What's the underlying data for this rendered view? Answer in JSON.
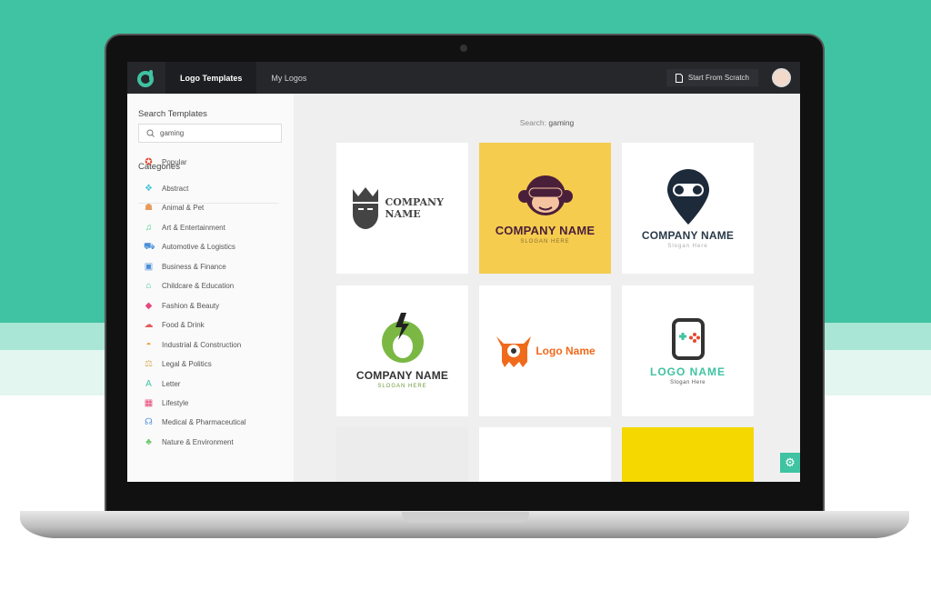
{
  "nav": {
    "tabs": [
      {
        "label": "Logo Templates",
        "active": true
      },
      {
        "label": "My Logos",
        "active": false
      }
    ],
    "start_from_scratch": "Start From Scratch"
  },
  "sidebar": {
    "search_heading": "Search Templates",
    "search_value": "gaming",
    "categories_heading": "Categories",
    "categories": [
      {
        "label": "Popular",
        "icon": "star-icon",
        "color": "#e8472e"
      },
      {
        "label": "Abstract",
        "icon": "abstract-icon",
        "color": "#49c6d8"
      },
      {
        "label": "Animal & Pet",
        "icon": "paw-icon",
        "color": "#e89a5a"
      },
      {
        "label": "Art & Entertainment",
        "icon": "music-note-icon",
        "color": "#4ccf8c"
      },
      {
        "label": "Automotive & Logistics",
        "icon": "car-icon",
        "color": "#4a8fd8"
      },
      {
        "label": "Business & Finance",
        "icon": "briefcase-icon",
        "color": "#4a8fd8"
      },
      {
        "label": "Childcare & Education",
        "icon": "graduation-cap-icon",
        "color": "#3fc3a2"
      },
      {
        "label": "Fashion & Beauty",
        "icon": "diamond-icon",
        "color": "#e8477a"
      },
      {
        "label": "Food & Drink",
        "icon": "chef-hat-icon",
        "color": "#e85a5a"
      },
      {
        "label": "Industrial & Construction",
        "icon": "helmet-icon",
        "color": "#f0a040"
      },
      {
        "label": "Legal & Politics",
        "icon": "scales-icon",
        "color": "#d8b060"
      },
      {
        "label": "Letter",
        "icon": "letter-icon",
        "color": "#3fc3a2"
      },
      {
        "label": "Lifestyle",
        "icon": "gift-icon",
        "color": "#e8477a"
      },
      {
        "label": "Medical & Pharmaceutical",
        "icon": "stethoscope-icon",
        "color": "#4a8fd8"
      },
      {
        "label": "Nature & Environment",
        "icon": "tree-icon",
        "color": "#6cc86c"
      }
    ]
  },
  "main": {
    "search_label": "Search:",
    "search_term": "gaming",
    "tiles": [
      {
        "name": "COMPANY NAME",
        "bg": "#ffffff"
      },
      {
        "name": "COMPANY NAME",
        "slogan": "SLOGAN HERE",
        "bg": "#f5cc4d"
      },
      {
        "name": "COMPANY NAME",
        "slogan": "Slogan Here",
        "bg": "#ffffff"
      },
      {
        "name": "COMPANY NAME",
        "slogan": "SLOGAN HERE",
        "bg": "#ffffff"
      },
      {
        "name": "Logo Name",
        "bg": "#ffffff"
      },
      {
        "name": "LOGO NAME",
        "slogan": "Slogan Here",
        "bg": "#ffffff"
      }
    ]
  },
  "colors": {
    "accent": "#3fc3a2",
    "topbar": "#26272b"
  }
}
